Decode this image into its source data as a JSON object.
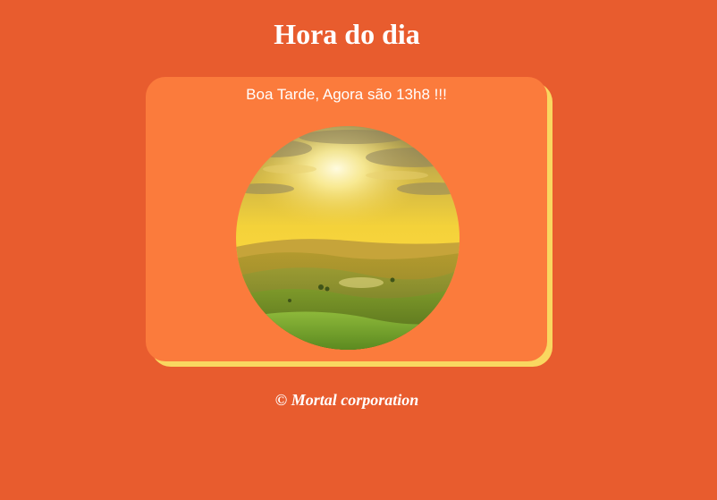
{
  "page": {
    "title": "Hora do dia",
    "background_color": "#e85c2e"
  },
  "card": {
    "greeting": "Boa Tarde, Agora são 13h8 !!!",
    "background_color": "#fb7b3c",
    "shadow_color": "#f9d760",
    "image": {
      "alt": "sunset-landscape"
    }
  },
  "footer": {
    "text": "© Mortal corporation"
  }
}
